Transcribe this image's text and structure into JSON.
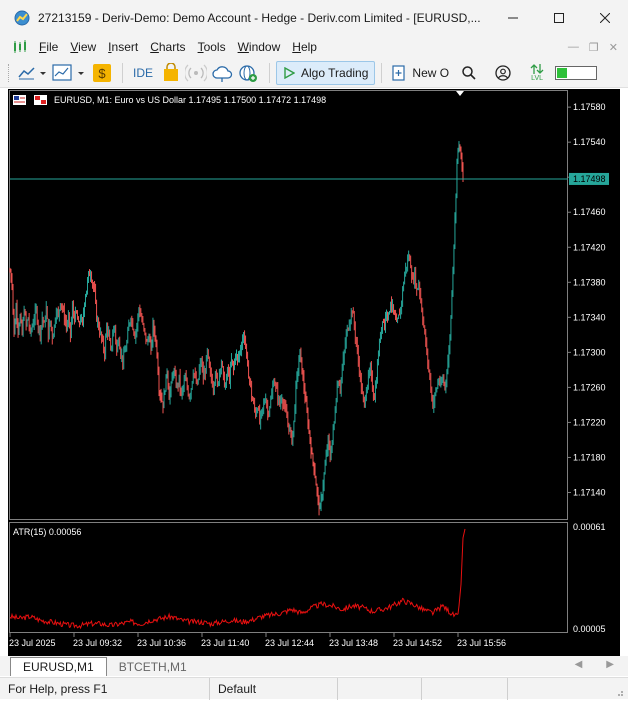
{
  "window": {
    "title": "27213159 - Deriv-Demo: Demo Account - Hedge - Deriv.com Limited - [EURUSD,..."
  },
  "menu": {
    "items": [
      {
        "label": "File",
        "underline": "F",
        "rest": "ile"
      },
      {
        "label": "View",
        "underline": "V",
        "rest": "iew"
      },
      {
        "label": "Insert",
        "underline": "I",
        "rest": "nsert"
      },
      {
        "label": "Charts",
        "underline": "C",
        "rest": "harts"
      },
      {
        "label": "Tools",
        "underline": "T",
        "rest": "ools"
      },
      {
        "label": "Window",
        "underline": "W",
        "rest": "indow"
      },
      {
        "label": "Help",
        "underline": "H",
        "rest": "elp"
      }
    ]
  },
  "toolbar": {
    "ide_label": "IDE",
    "algo_trading_label": "Algo Trading",
    "new_order_label": "New O",
    "lvl_label": "LVL",
    "connection_level": 0.25,
    "colors": {
      "algo_bg": "#dcecfa",
      "battery": "#2fc13a"
    }
  },
  "chart": {
    "info": "EURUSD, M1:  Euro vs US Dollar  1.17495 1.17500 1.17472 1.17498",
    "current_price": "1.17498",
    "price_ticks": [
      "1.17580",
      "1.17540",
      "1.17500",
      "1.17460",
      "1.17420",
      "1.17380",
      "1.17340",
      "1.17300",
      "1.17260",
      "1.17220",
      "1.17180",
      "1.17140"
    ],
    "indicator_label": "ATR(15) 0.00056",
    "indicator_ticks": [
      "0.00061",
      "0.00005"
    ],
    "time_labels": [
      "23 Jul 2025",
      "23 Jul 09:32",
      "23 Jul 10:36",
      "23 Jul 11:40",
      "23 Jul 12:44",
      "23 Jul 13:48",
      "23 Jul 14:52",
      "23 Jul 15:56"
    ],
    "colors": {
      "background": "#000000",
      "bull": "#26a69a",
      "bear": "#ef5350",
      "atr_line": "#e81010",
      "price_line": "#26a69a"
    }
  },
  "chart_data": {
    "type": "candlestick",
    "symbol": "EURUSD",
    "timeframe": "M1",
    "ylim": [
      1.17112,
      1.17595
    ],
    "last_ohlc": [
      1.17495,
      1.175,
      1.17472,
      1.17498
    ],
    "close_path": [
      [
        0,
        1.17392
      ],
      [
        2,
        1.1738
      ],
      [
        4,
        1.1732
      ],
      [
        6,
        1.17352
      ],
      [
        8,
        1.17328
      ],
      [
        10,
        1.1734
      ],
      [
        12,
        1.1732
      ],
      [
        14,
        1.1735
      ],
      [
        16,
        1.1733
      ],
      [
        18,
        1.1734
      ],
      [
        20,
        1.1732
      ],
      [
        22,
        1.1733
      ],
      [
        24,
        1.1734
      ],
      [
        26,
        1.17348
      ],
      [
        28,
        1.1733
      ],
      [
        30,
        1.17322
      ],
      [
        32,
        1.1734
      ],
      [
        34,
        1.1733
      ],
      [
        36,
        1.1735
      ],
      [
        38,
        1.1732
      ],
      [
        40,
        1.17336
      ],
      [
        42,
        1.17318
      ],
      [
        44,
        1.1733
      ],
      [
        46,
        1.1735
      ],
      [
        48,
        1.1734
      ],
      [
        50,
        1.1736
      ],
      [
        52,
        1.1735
      ],
      [
        54,
        1.1734
      ],
      [
        56,
        1.1733
      ],
      [
        58,
        1.17338
      ],
      [
        60,
        1.1732
      ],
      [
        62,
        1.1735
      ],
      [
        64,
        1.1734
      ],
      [
        66,
        1.17344
      ],
      [
        68,
        1.1733
      ],
      [
        70,
        1.1734
      ],
      [
        72,
        1.1733
      ],
      [
        74,
        1.1736
      ],
      [
        76,
        1.17372
      ],
      [
        78,
        1.17388
      ],
      [
        80,
        1.17392
      ],
      [
        82,
        1.1738
      ],
      [
        84,
        1.17368
      ],
      [
        86,
        1.1734
      ],
      [
        88,
        1.1733
      ],
      [
        90,
        1.1732
      ],
      [
        92,
        1.1731
      ],
      [
        94,
        1.173
      ],
      [
        96,
        1.1733
      ],
      [
        98,
        1.1732
      ],
      [
        100,
        1.173
      ],
      [
        102,
        1.1732
      ],
      [
        104,
        1.1733
      ],
      [
        106,
        1.173
      ],
      [
        108,
        1.17318
      ],
      [
        110,
        1.173
      ],
      [
        112,
        1.1729
      ],
      [
        114,
        1.173
      ],
      [
        116,
        1.1731
      ],
      [
        118,
        1.1733
      ],
      [
        120,
        1.17342
      ],
      [
        122,
        1.1733
      ],
      [
        124,
        1.1732
      ],
      [
        126,
        1.1733
      ],
      [
        128,
        1.1735
      ],
      [
        130,
        1.17342
      ],
      [
        132,
        1.1733
      ],
      [
        134,
        1.1732
      ],
      [
        136,
        1.1731
      ],
      [
        138,
        1.1732
      ],
      [
        140,
        1.173
      ],
      [
        142,
        1.1733
      ],
      [
        144,
        1.1732
      ],
      [
        146,
        1.173
      ],
      [
        148,
        1.1726
      ],
      [
        150,
        1.1725
      ],
      [
        152,
        1.1724
      ],
      [
        154,
        1.1726
      ],
      [
        156,
        1.1728
      ],
      [
        158,
        1.1725
      ],
      [
        160,
        1.1726
      ],
      [
        162,
        1.1728
      ],
      [
        164,
        1.1727
      ],
      [
        166,
        1.1726
      ],
      [
        168,
        1.1727
      ],
      [
        170,
        1.1725
      ],
      [
        172,
        1.1726
      ],
      [
        174,
        1.1727
      ],
      [
        176,
        1.1726
      ],
      [
        178,
        1.1725
      ],
      [
        180,
        1.1726
      ],
      [
        182,
        1.1728
      ],
      [
        184,
        1.1727
      ],
      [
        186,
        1.1726
      ],
      [
        188,
        1.1728
      ],
      [
        190,
        1.1729
      ],
      [
        192,
        1.1727
      ],
      [
        194,
        1.1728
      ],
      [
        196,
        1.173
      ],
      [
        198,
        1.1728
      ],
      [
        200,
        1.1727
      ],
      [
        202,
        1.1726
      ],
      [
        204,
        1.1728
      ],
      [
        206,
        1.1726
      ],
      [
        208,
        1.1728
      ],
      [
        210,
        1.1729
      ],
      [
        212,
        1.1727
      ],
      [
        214,
        1.1726
      ],
      [
        216,
        1.1728
      ],
      [
        218,
        1.1727
      ],
      [
        220,
        1.1729
      ],
      [
        222,
        1.1728
      ],
      [
        224,
        1.173
      ],
      [
        226,
        1.1729
      ],
      [
        228,
        1.173
      ],
      [
        230,
        1.1731
      ],
      [
        232,
        1.1732
      ],
      [
        234,
        1.1731
      ],
      [
        236,
        1.1728
      ],
      [
        238,
        1.1727
      ],
      [
        240,
        1.1725
      ],
      [
        242,
        1.1724
      ],
      [
        244,
        1.1723
      ],
      [
        246,
        1.1724
      ],
      [
        248,
        1.1722
      ],
      [
        250,
        1.1723
      ],
      [
        252,
        1.1724
      ],
      [
        254,
        1.1725
      ],
      [
        256,
        1.1723
      ],
      [
        258,
        1.1724
      ],
      [
        260,
        1.1725
      ],
      [
        262,
        1.1727
      ],
      [
        264,
        1.1726
      ],
      [
        266,
        1.1725
      ],
      [
        268,
        1.1724
      ],
      [
        270,
        1.1725
      ],
      [
        272,
        1.1724
      ],
      [
        274,
        1.1723
      ],
      [
        276,
        1.1722
      ],
      [
        278,
        1.1721
      ],
      [
        280,
        1.172
      ],
      [
        282,
        1.1722
      ],
      [
        284,
        1.1726
      ],
      [
        286,
        1.1728
      ],
      [
        288,
        1.173
      ],
      [
        290,
        1.1728
      ],
      [
        292,
        1.1726
      ],
      [
        294,
        1.1724
      ],
      [
        296,
        1.1722
      ],
      [
        298,
        1.172
      ],
      [
        300,
        1.1718
      ],
      [
        302,
        1.1717
      ],
      [
        304,
        1.1715
      ],
      [
        306,
        1.1713
      ],
      [
        308,
        1.1712
      ],
      [
        310,
        1.1714
      ],
      [
        312,
        1.1716
      ],
      [
        314,
        1.1718
      ],
      [
        316,
        1.172
      ],
      [
        318,
        1.1718
      ],
      [
        320,
        1.172
      ],
      [
        322,
        1.1722
      ],
      [
        324,
        1.1725
      ],
      [
        326,
        1.1727
      ],
      [
        328,
        1.1726
      ],
      [
        330,
        1.1728
      ],
      [
        332,
        1.173
      ],
      [
        334,
        1.1732
      ],
      [
        336,
        1.1733
      ],
      [
        338,
        1.1734
      ],
      [
        340,
        1.1735
      ],
      [
        342,
        1.1733
      ],
      [
        344,
        1.1731
      ],
      [
        346,
        1.1729
      ],
      [
        348,
        1.1727
      ],
      [
        350,
        1.1725
      ],
      [
        352,
        1.1724
      ],
      [
        354,
        1.1726
      ],
      [
        356,
        1.1727
      ],
      [
        358,
        1.1728
      ],
      [
        360,
        1.1726
      ],
      [
        362,
        1.1725
      ],
      [
        364,
        1.1727
      ],
      [
        366,
        1.173
      ],
      [
        368,
        1.1732
      ],
      [
        370,
        1.1734
      ],
      [
        372,
        1.1733
      ],
      [
        374,
        1.1735
      ],
      [
        376,
        1.1734
      ],
      [
        378,
        1.1736
      ],
      [
        380,
        1.1735
      ],
      [
        382,
        1.1734
      ],
      [
        384,
        1.1733
      ],
      [
        386,
        1.1734
      ],
      [
        388,
        1.1735
      ],
      [
        390,
        1.1737
      ],
      [
        392,
        1.1739
      ],
      [
        394,
        1.174
      ],
      [
        396,
        1.1741
      ],
      [
        398,
        1.174
      ],
      [
        400,
        1.1738
      ],
      [
        402,
        1.1739
      ],
      [
        404,
        1.1737
      ],
      [
        406,
        1.1738
      ],
      [
        408,
        1.1736
      ],
      [
        410,
        1.1734
      ],
      [
        412,
        1.1732
      ],
      [
        414,
        1.173
      ],
      [
        416,
        1.1728
      ],
      [
        418,
        1.1726
      ],
      [
        420,
        1.1724
      ],
      [
        422,
        1.1725
      ],
      [
        424,
        1.1726
      ],
      [
        426,
        1.1727
      ],
      [
        428,
        1.1726
      ],
      [
        430,
        1.1727
      ],
      [
        432,
        1.1726
      ],
      [
        434,
        1.1728
      ],
      [
        436,
        1.173
      ],
      [
        438,
        1.1734
      ],
      [
        440,
        1.174
      ],
      [
        442,
        1.1745
      ],
      [
        444,
        1.1752
      ],
      [
        446,
        1.1754
      ],
      [
        448,
        1.1752
      ],
      [
        450,
        1.17498
      ]
    ],
    "atr_label": "ATR(15) 0.00056",
    "atr_ylim": [
      5e-05,
      0.00061
    ],
    "atr_path": [
      [
        0,
        0.00012
      ],
      [
        10,
        0.00011
      ],
      [
        20,
        0.00012
      ],
      [
        30,
        0.0001
      ],
      [
        40,
        9e-05
      ],
      [
        50,
        8e-05
      ],
      [
        60,
        7e-05
      ],
      [
        70,
        7e-05
      ],
      [
        80,
        8e-05
      ],
      [
        90,
        8e-05
      ],
      [
        100,
        7e-05
      ],
      [
        110,
        8e-05
      ],
      [
        120,
        9e-05
      ],
      [
        130,
        8e-05
      ],
      [
        140,
        0.0001
      ],
      [
        150,
        0.00011
      ],
      [
        160,
        0.00012
      ],
      [
        170,
        0.0001
      ],
      [
        180,
        9e-05
      ],
      [
        190,
        9e-05
      ],
      [
        200,
        8e-05
      ],
      [
        210,
        9e-05
      ],
      [
        220,
        0.0001
      ],
      [
        230,
        9e-05
      ],
      [
        240,
        0.0001
      ],
      [
        250,
        0.00012
      ],
      [
        260,
        0.00013
      ],
      [
        270,
        0.00014
      ],
      [
        280,
        0.00016
      ],
      [
        290,
        0.00014
      ],
      [
        300,
        0.00017
      ],
      [
        310,
        0.00019
      ],
      [
        320,
        0.00018
      ],
      [
        330,
        0.00016
      ],
      [
        340,
        0.00018
      ],
      [
        350,
        0.00017
      ],
      [
        360,
        0.00015
      ],
      [
        370,
        0.00016
      ],
      [
        380,
        0.00018
      ],
      [
        390,
        0.00021
      ],
      [
        400,
        0.00019
      ],
      [
        410,
        0.00016
      ],
      [
        420,
        0.00014
      ],
      [
        430,
        0.00018
      ],
      [
        440,
        0.00013
      ],
      [
        445,
        0.00012
      ],
      [
        448,
        0.0003
      ],
      [
        450,
        0.00056
      ],
      [
        452,
        0.00061
      ]
    ]
  },
  "tabs": [
    {
      "label": "EURUSD,M1",
      "active": true
    },
    {
      "label": "BTCETH,M1",
      "active": false
    }
  ],
  "status": {
    "help_text": "For Help, press F1",
    "profile": "Default"
  }
}
